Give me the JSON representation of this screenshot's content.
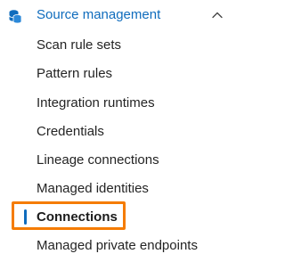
{
  "section": {
    "title": "Source management",
    "icon": "database-icon",
    "chevron_icon": "chevron-up-icon",
    "expanded": true,
    "accent_color": "#0f6cbd"
  },
  "items": [
    {
      "label": "Scan rule sets",
      "selected": false
    },
    {
      "label": "Pattern rules",
      "selected": false
    },
    {
      "label": "Integration runtimes",
      "selected": false
    },
    {
      "label": "Credentials",
      "selected": false
    },
    {
      "label": "Lineage connections",
      "selected": false
    },
    {
      "label": "Managed identities",
      "selected": false
    },
    {
      "label": "Connections",
      "selected": true
    },
    {
      "label": "Managed private endpoints",
      "selected": false
    }
  ],
  "highlight_color": "#f57c00"
}
